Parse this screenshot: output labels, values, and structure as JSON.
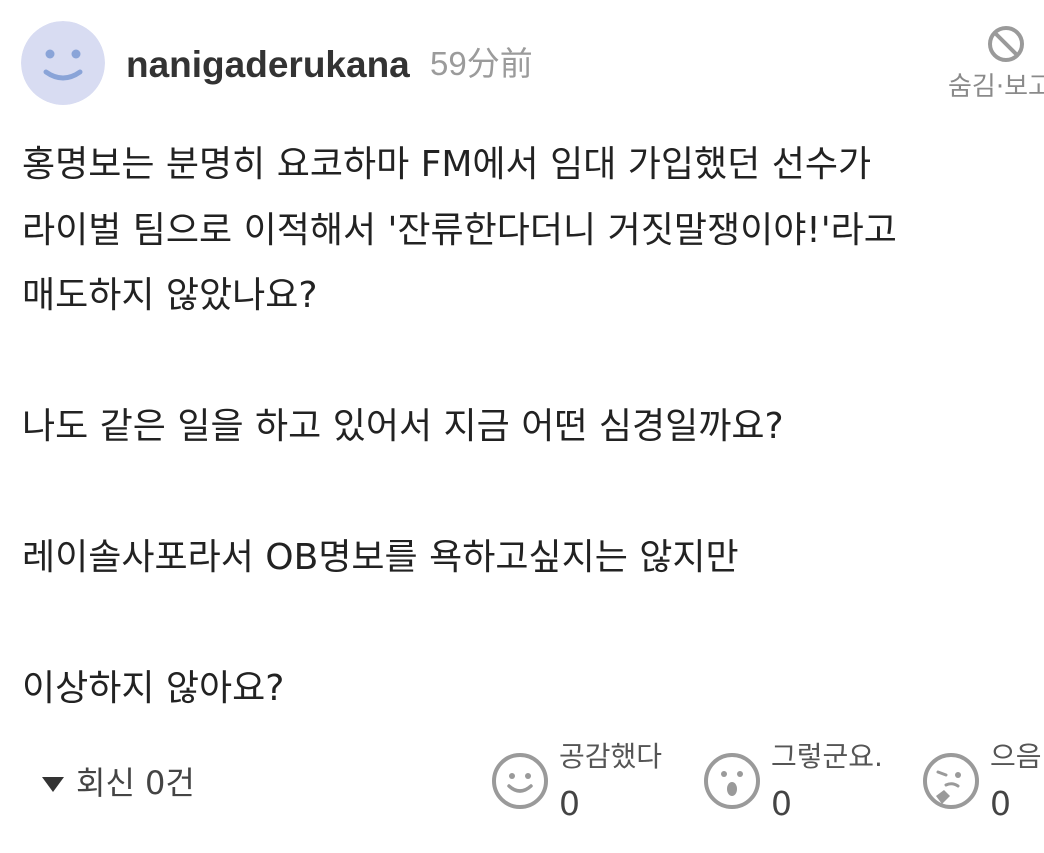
{
  "comment": {
    "username": "nanigaderukana",
    "timestamp": "59分前",
    "hide_label": "숨김·보고",
    "body_lines": [
      "홍명보는 분명히 요코하마 FM에서 임대 가입했던 선수가",
      "라이벌 팀으로 이적해서 '잔류한다더니 거짓말쟁이야!'라고",
      "매도하지 않았나요?",
      "",
      "나도 같은 일을 하고 있어서 지금 어떤 심경일까요?",
      "",
      "레이솔사포라서 OB명보를 욕하고싶지는 않지만",
      "",
      "이상하지 않아요?"
    ],
    "replies_label": "회신 0건",
    "reactions": [
      {
        "label": "공감했다",
        "count": "0",
        "icon": "smile-face-icon"
      },
      {
        "label": "그렇군요.",
        "count": "0",
        "icon": "surprised-face-icon"
      },
      {
        "label": "으음",
        "count": "0",
        "icon": "thinking-face-icon"
      }
    ]
  },
  "colors": {
    "avatar_bg": "#d8dcf2",
    "avatar_features": "#8aa4d8",
    "icon_gray": "#9a9a9a",
    "text": "#222222",
    "muted": "#9b9b9b"
  }
}
